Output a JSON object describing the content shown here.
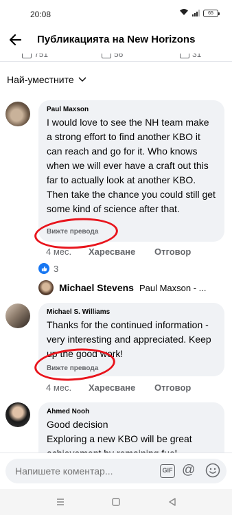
{
  "status": {
    "time": "20:08",
    "battery": "65"
  },
  "header": {
    "title": "Публикацията на New Horizons"
  },
  "reaction_strip": {
    "likes": "751",
    "comments": "56",
    "shares": "31"
  },
  "sort": {
    "label": "Най-уместните"
  },
  "comments": [
    {
      "author": "Paul Maxson",
      "text": "I would love to see the NH team make a strong effort to find another KBO it can reach and go for it. Who knows when we will ever have a craft out this far to actually look at another KBO. Then take the chance you could still get some kind of science after that.",
      "translate": "Вижте превода",
      "age": "4 мес.",
      "like": "Харесване",
      "reply": "Отговор",
      "reaction_count": "3",
      "reply_preview": {
        "name": "Michael Stevens",
        "text": "Paul Maxson - ..."
      }
    },
    {
      "author": "Michael S. Williams",
      "text": "Thanks for the continued information - very interesting and appreciated. Keep up the good work!",
      "translate": "Вижте превода",
      "age": "4 мес.",
      "like": "Харесване",
      "reply": "Отговор"
    },
    {
      "author": "Ahmed Nooh",
      "text": "Good decision\nExploring a new KBO will be great achievement by remaining fuel"
    }
  ],
  "composer": {
    "placeholder": "Напишете коментар...",
    "gif": "GIF",
    "at": "@"
  },
  "colors": {
    "accent": "#1877f2",
    "bubble": "#f0f2f5",
    "secondary_text": "#65676b",
    "annotation": "#e8141c"
  }
}
